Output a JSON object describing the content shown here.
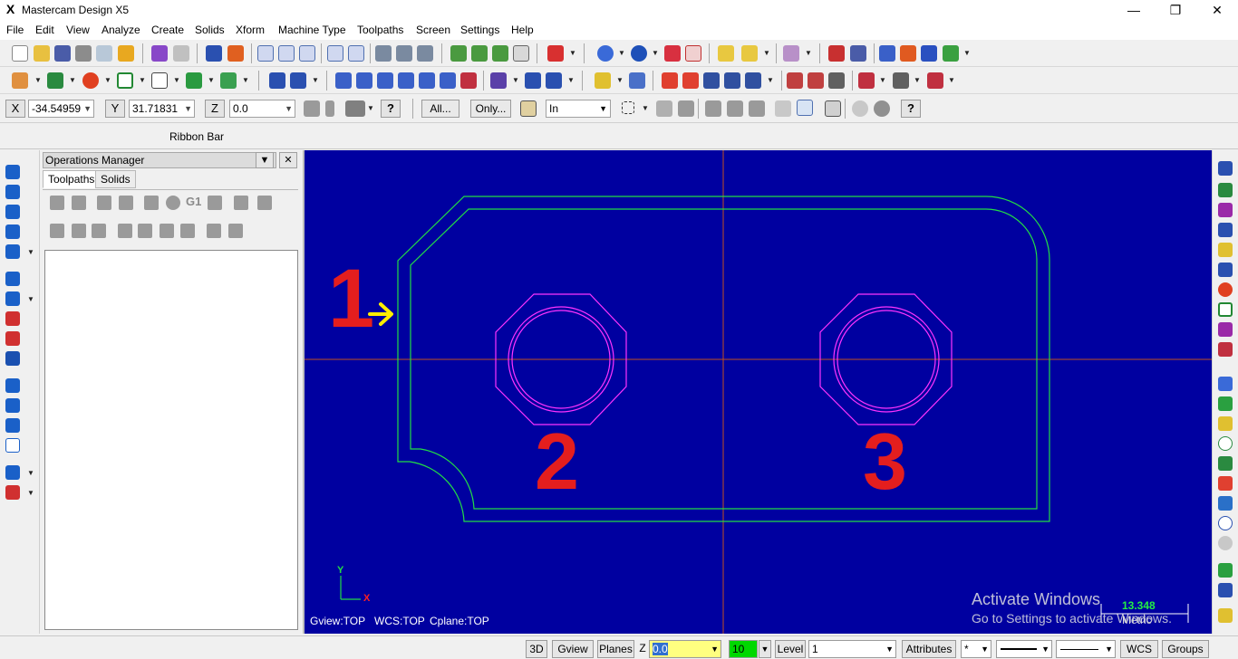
{
  "window": {
    "title": "Mastercam Design X5",
    "app_icon": "X",
    "controls": [
      "minimize-icon",
      "maximize-icon",
      "close-icon"
    ]
  },
  "menu": [
    "File",
    "Edit",
    "View",
    "Analyze",
    "Create",
    "Solids",
    "Xform",
    "Machine Type",
    "Toolpaths",
    "Screen",
    "Settings",
    "Help"
  ],
  "ribbon": {
    "x_label": "X",
    "x_value": "-34.54959",
    "y_label": "Y",
    "y_value": "31.71831",
    "z_label": "Z",
    "z_value": "0.0",
    "all_button": "All...",
    "only_button": "Only...",
    "mode_select": "In",
    "bar_label": "Ribbon Bar"
  },
  "ops_manager": {
    "title": "Operations Manager",
    "tabs": [
      "Toolpaths",
      "Solids"
    ],
    "active_tab": "Toolpaths",
    "g1_label": "G1"
  },
  "viewport": {
    "background": "#0000a0",
    "gview": "Gview:TOP",
    "wcs": "WCS:TOP",
    "cplane": "Cplane:TOP",
    "axis_y": "Y",
    "axis_x": "X",
    "annotations": [
      "1",
      "2",
      "3"
    ],
    "scale_value": "13.348",
    "scale_units": "Metric",
    "watermark_line1": "Activate Windows",
    "watermark_line2": "Go to Settings to activate Windows.",
    "colors": {
      "outline": "#22dd44",
      "hole": "#ff33ff",
      "crosshair": "#c05020",
      "annotation": "#e41e1e",
      "arrow": "#ffee00"
    }
  },
  "statusbar": {
    "btn_3d": "3D",
    "gview": "Gview",
    "planes": "Planes",
    "z_label": "Z",
    "z_value": "0.0",
    "color_value": "10",
    "level_label": "Level",
    "level_value": "1",
    "attributes": "Attributes",
    "point_style": "*",
    "wcs": "WCS",
    "groups": "Groups"
  }
}
